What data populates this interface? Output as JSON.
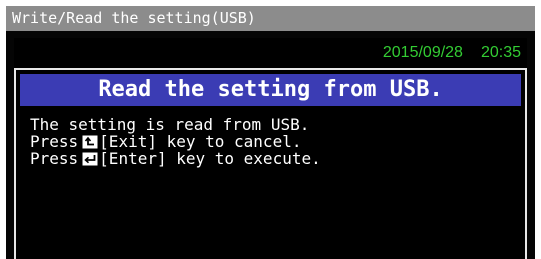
{
  "window": {
    "title": "Write/Read the setting(USB)"
  },
  "status": {
    "date": "2015/09/28",
    "time": "20:35"
  },
  "dialog": {
    "heading": "Read the setting from USB.",
    "line1": "The setting is read from USB.",
    "line2_prefix": "Press",
    "line2_key": "[Exit] key to cancel.",
    "line3_prefix": "Press",
    "line3_key": "[Enter] key to execute."
  },
  "colors": {
    "title_bar": "#8c8c8c",
    "status_text": "#33cc33",
    "heading_band": "#3b3cb4",
    "background": "#000000",
    "text": "#ffffff"
  },
  "icons": {
    "exit_key": "exit-key-icon",
    "enter_key": "enter-key-icon"
  }
}
